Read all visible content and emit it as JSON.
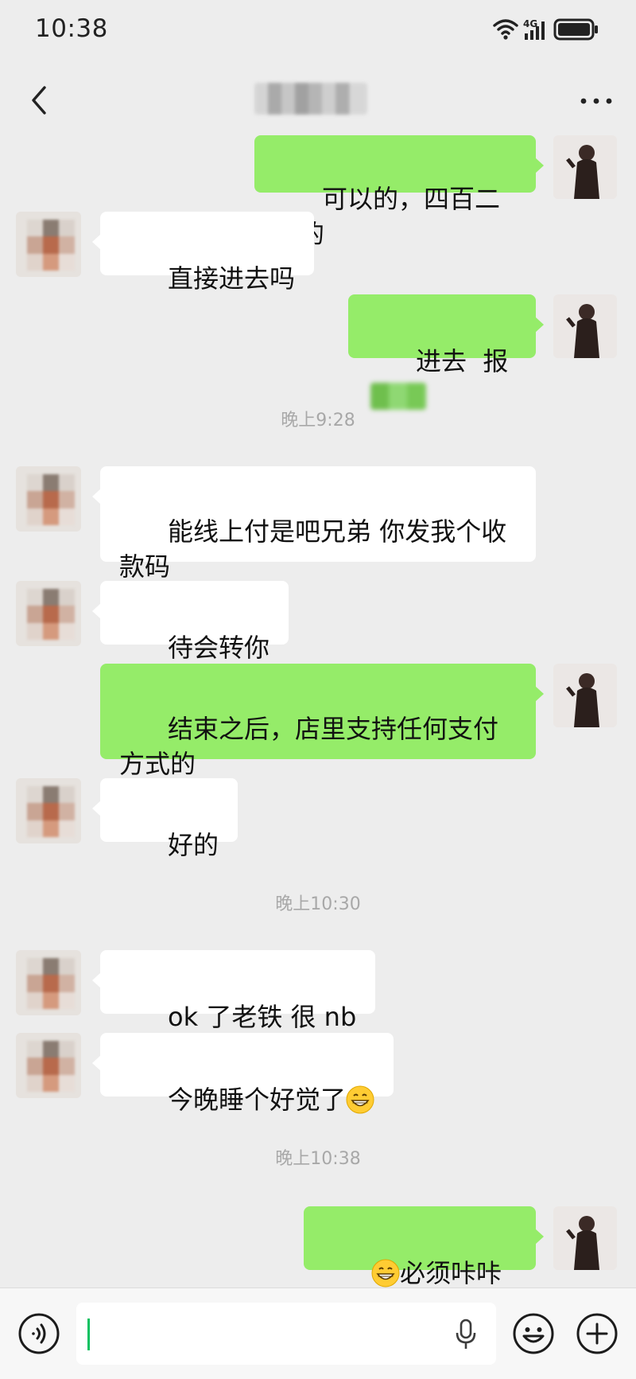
{
  "status_bar": {
    "time": "10:38",
    "network": "4G"
  },
  "header": {
    "contact_name_redacted": true
  },
  "messages": [
    {
      "side": "out",
      "text": "可以的，四百二对的"
    },
    {
      "side": "in",
      "text": "直接进去吗"
    },
    {
      "side": "out",
      "text": "进去  报",
      "redacted_suffix": true
    },
    {
      "type": "time",
      "text": "晚上9:28"
    },
    {
      "side": "in",
      "text": "能线上付是吧兄弟 你发我个收款码"
    },
    {
      "side": "in",
      "text": "待会转你"
    },
    {
      "side": "out",
      "text": "结束之后，店里支持任何支付方式的"
    },
    {
      "side": "in",
      "text": "好的"
    },
    {
      "type": "time",
      "text": "晚上10:30"
    },
    {
      "side": "in",
      "text": "ok 了老铁 很 nb"
    },
    {
      "side": "in",
      "text": "今晚睡个好觉了",
      "emoji_after": "grinning-face"
    },
    {
      "type": "time",
      "text": "晚上10:38"
    },
    {
      "side": "out",
      "text": "必须咔咔到位",
      "emoji_before": "grinning-face"
    }
  ],
  "colors": {
    "background": "#ededed",
    "outgoing_bubble": "#95ec69",
    "incoming_bubble": "#ffffff",
    "accent": "#07c160"
  }
}
